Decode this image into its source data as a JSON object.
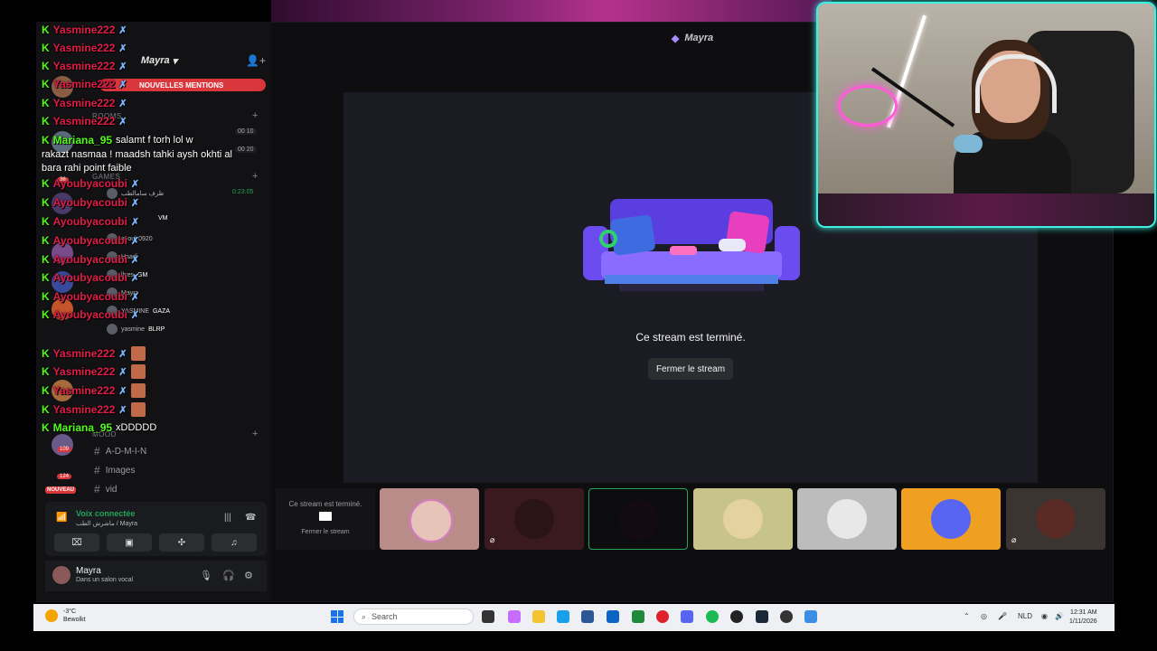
{
  "app": {
    "title": "Mayra",
    "server_name": "Mayra",
    "new_mentions": "NOUVELLES MENTIONS",
    "badge_nouveau": "NOUVEAU"
  },
  "channels": {
    "cat_rooms": "ROOMS",
    "cat_games": "GAMES",
    "cat_mood": "MOOD",
    "items": [
      "A-D-M-I-N",
      "Images",
      "vid"
    ],
    "counters": [
      "00 10",
      "00 20"
    ],
    "voice_users": [
      "ظرف سامالطب",
      "ayoub0920",
      "Haadi",
      "llyes",
      "Mayra",
      "YASMINE",
      "yasmine"
    ],
    "voice_tags": [
      "VM",
      "GM",
      "GAZA",
      "BLRP"
    ],
    "voice_time": "0:23:05"
  },
  "server_badges": [
    "36",
    "109",
    "124"
  ],
  "chat": {
    "messages": [
      {
        "user": "Yasmine222",
        "text": ""
      },
      {
        "user": "Yasmine222",
        "text": ""
      },
      {
        "user": "Yasmine222",
        "text": ""
      },
      {
        "user": "Yasmine222",
        "text": ""
      },
      {
        "user": "Yasmine222",
        "text": ""
      },
      {
        "user": "Yasmine222",
        "text": ""
      },
      {
        "user": "Ayoubyacoubi",
        "text": ""
      },
      {
        "user": "Ayoubyacoubi",
        "text": ""
      },
      {
        "user": "Ayoubyacoubi",
        "text": ""
      },
      {
        "user": "Ayoubyacoubi",
        "text": ""
      },
      {
        "user": "Ayoubyacoubi",
        "text": ""
      },
      {
        "user": "Ayoubyacoubi",
        "text": ""
      },
      {
        "user": "Ayoubyacoubi",
        "text": ""
      },
      {
        "user": "Ayoubyacoubi",
        "text": ""
      },
      {
        "user": "Yasmine222",
        "text": ""
      },
      {
        "user": "Yasmine222",
        "text": ""
      },
      {
        "user": "Yasmine222",
        "text": ""
      },
      {
        "user": "Yasmine222",
        "text": ""
      }
    ],
    "mariana1_user": "Mariana_95",
    "mariana1_text": "salamt f torh lol w",
    "mariana1_cont": "rakazt nasmaa ! maadsh tahki aysh okhti al bara rahi point faible",
    "mariana2_user": "Mariana_95",
    "mariana2_text": "xDDDDD"
  },
  "voice_panel": {
    "status": "Voix connectée",
    "channel": "ماشرش الطب / Mayra"
  },
  "user_bar": {
    "name": "Mayra",
    "status": "Dans un salon vocal"
  },
  "stream": {
    "ended_text": "Ce stream est terminé.",
    "close_button": "Fermer le stream"
  },
  "thumbnails": {
    "ended_text": "Ce stream est terminé.",
    "close_text": "Fermer le stream"
  },
  "taskbar": {
    "temp": "-3°C",
    "weather": "Bewolkt",
    "search_placeholder": "Search",
    "lang": "NLD",
    "time": "12:31 AM",
    "date": "1/11/2026"
  },
  "colors": {
    "accent_red": "#da373c",
    "kick_green": "#53fc18",
    "webcam_border": "#3ef0e0"
  }
}
